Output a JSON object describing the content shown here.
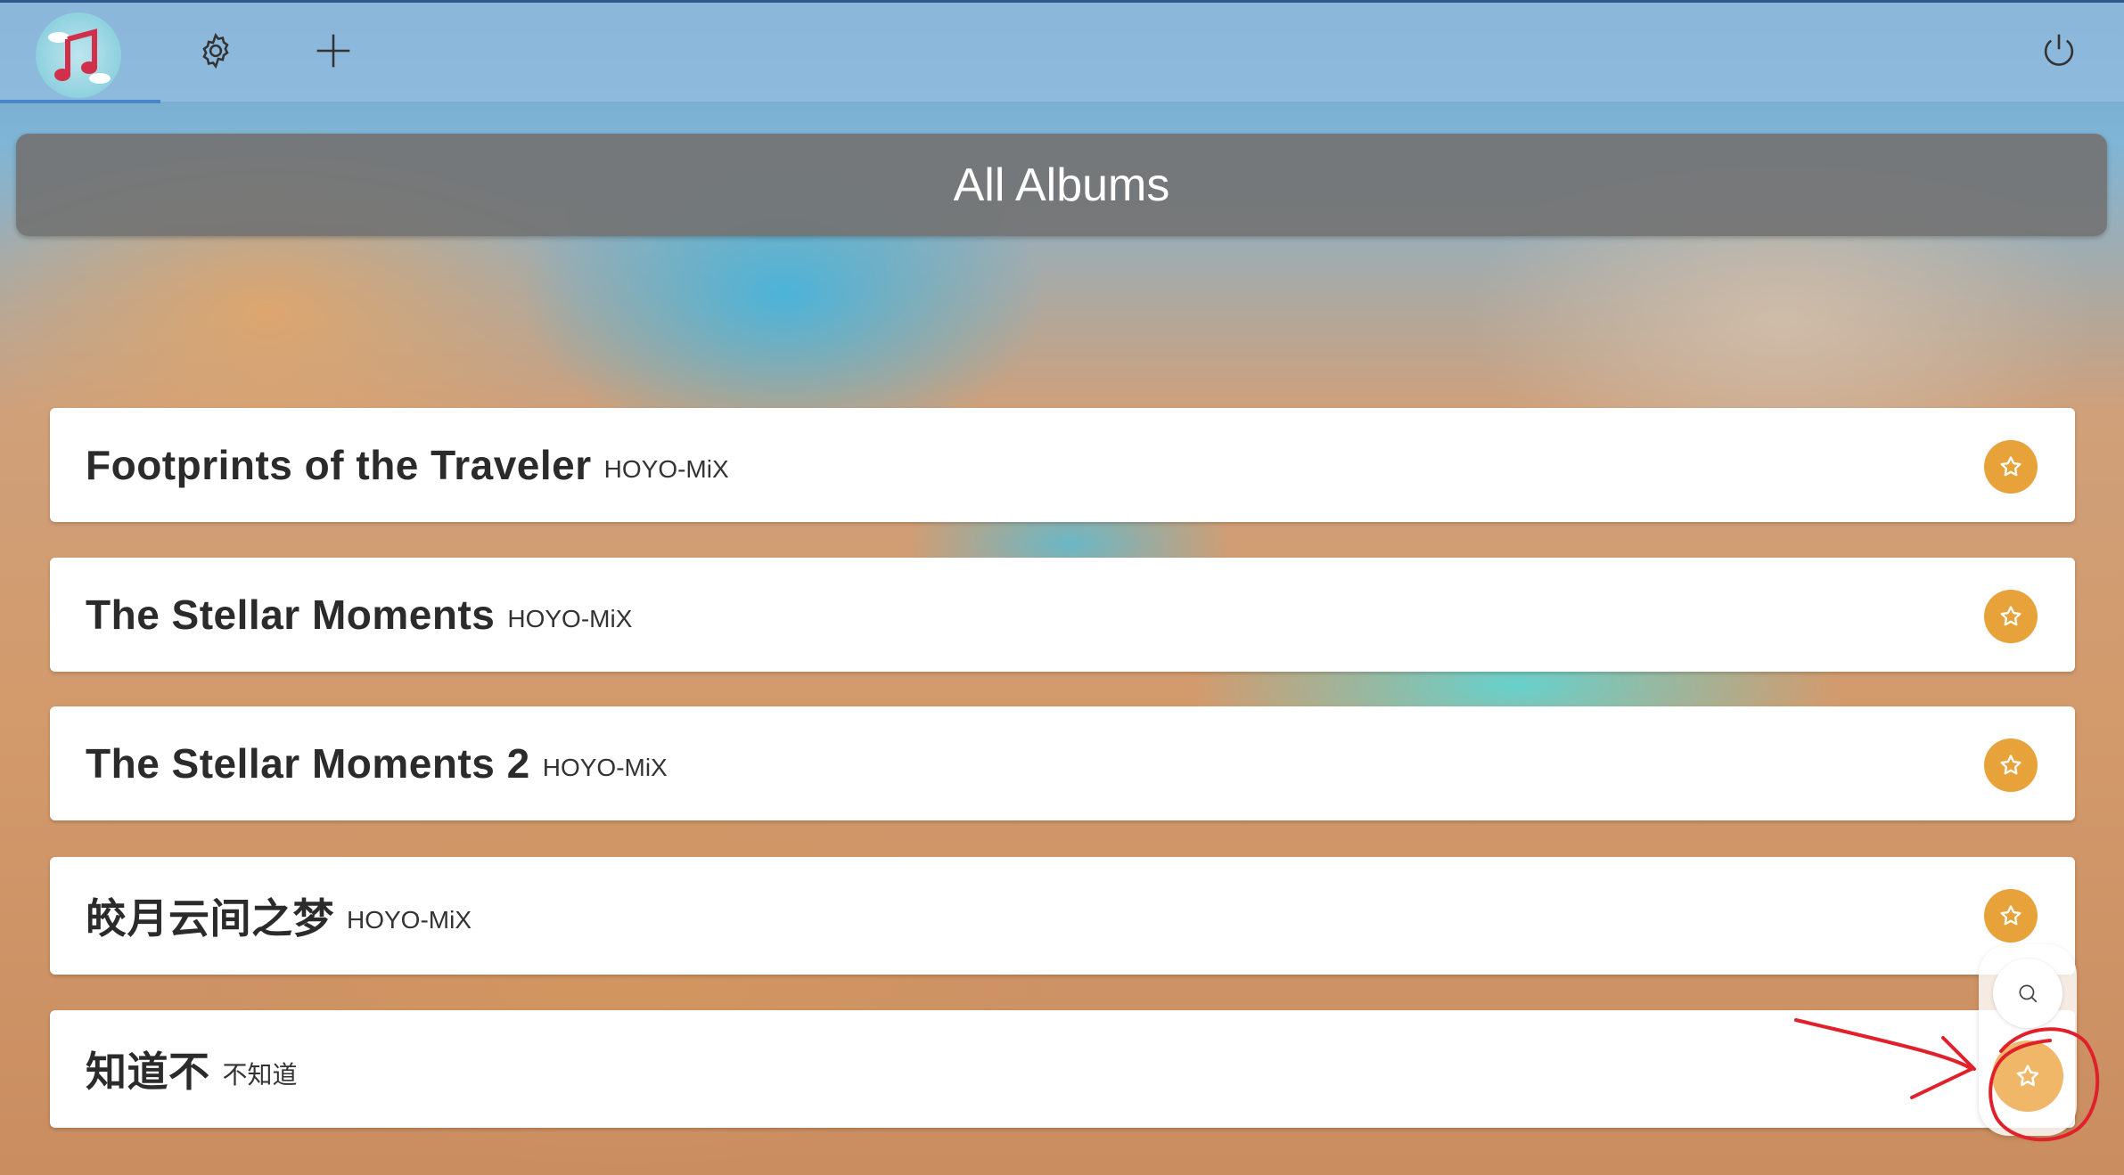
{
  "app": {
    "nav": [
      {
        "icon": "music-note-logo-icon"
      },
      {
        "icon": "gear-icon"
      },
      {
        "icon": "plus-icon"
      }
    ],
    "power_icon": "power-icon"
  },
  "header": {
    "title": "All Albums"
  },
  "albums": [
    {
      "title": "Footprints of the Traveler",
      "artist": "HOYO-MiX"
    },
    {
      "title": "The Stellar Moments",
      "artist": "HOYO-MiX"
    },
    {
      "title": "The Stellar Moments 2",
      "artist": "HOYO-MiX"
    },
    {
      "title": "皎月云间之梦",
      "artist": "HOYO-MiX"
    },
    {
      "title": "知道不",
      "artist": "不知道"
    }
  ],
  "fab": {
    "search_icon": "search-icon",
    "favorite_icon": "star-icon"
  },
  "colors": {
    "topbar": "#96bee1",
    "header_bar": "#737373",
    "star_button": "#e8a23a",
    "fab_star": "#f0b769",
    "annotation": "#e0202a"
  }
}
